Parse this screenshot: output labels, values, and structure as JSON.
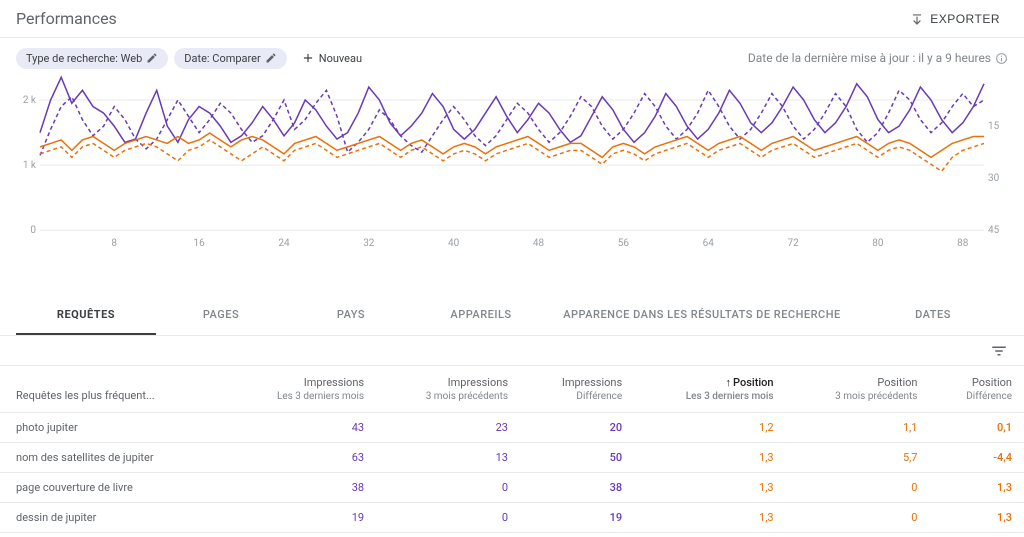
{
  "header": {
    "title": "Performances",
    "export_label": "EXPORTER"
  },
  "toolbar": {
    "chips": [
      {
        "label": "Type de recherche: Web",
        "editable": true
      },
      {
        "label": "Date: Comparer",
        "editable": true
      }
    ],
    "new_label": "Nouveau",
    "update_text": "Date de la dernière mise à jour : il y a 9 heures"
  },
  "tabs": {
    "items": [
      {
        "label": "REQUÊTES",
        "active": true
      },
      {
        "label": "PAGES",
        "active": false
      },
      {
        "label": "PAYS",
        "active": false
      },
      {
        "label": "APPAREILS",
        "active": false
      },
      {
        "label": "APPARENCE DANS LES RÉSULTATS DE RECHERCHE",
        "active": false
      },
      {
        "label": "DATES",
        "active": false
      }
    ]
  },
  "table": {
    "header": {
      "query": "Requêtes les plus fréquent...",
      "imp_cur": "Impressions",
      "imp_cur_sub": "Les 3 derniers mois",
      "imp_prev": "Impressions",
      "imp_prev_sub": "3 mois précédents",
      "imp_diff": "Impressions",
      "imp_diff_sub": "Différence",
      "pos_cur": "Position",
      "pos_cur_sub": "Les 3 derniers mois",
      "pos_prev": "Position",
      "pos_prev_sub": "3 mois précédents",
      "pos_diff": "Position",
      "pos_diff_sub": "Différence"
    },
    "rows": [
      {
        "q": "photo jupiter",
        "ic": "43",
        "ip": "23",
        "id": "20",
        "pc": "1,2",
        "pp": "1,1",
        "pd": "0,1"
      },
      {
        "q": "nom des satellites de jupiter",
        "ic": "63",
        "ip": "13",
        "id": "50",
        "pc": "1,3",
        "pp": "5,7",
        "pd": "-4,4"
      },
      {
        "q": "page couverture de livre",
        "ic": "38",
        "ip": "0",
        "id": "38",
        "pc": "1,3",
        "pp": "0",
        "pd": "1,3"
      },
      {
        "q": "dessin de jupiter",
        "ic": "19",
        "ip": "0",
        "id": "19",
        "pc": "1,3",
        "pp": "0",
        "pd": "1,3"
      }
    ]
  },
  "chart_data": {
    "type": "line",
    "x_ticks": [
      "8",
      "16",
      "24",
      "32",
      "40",
      "48",
      "56",
      "64",
      "72",
      "80",
      "88"
    ],
    "y_left_ticks": [
      "0",
      "1 k",
      "2 k"
    ],
    "y_left_range": [
      0,
      2400
    ],
    "y_right_ticks": [
      "15",
      "30",
      "45"
    ],
    "y_right_range": [
      0,
      45
    ],
    "colors": {
      "impressions": "#673ab7",
      "position": "#e8710a"
    },
    "series": [
      {
        "name": "Impressions — Les 3 derniers mois",
        "axis": "left",
        "style": "solid",
        "color": "#673ab7",
        "values": [
          1500,
          2000,
          2350,
          1950,
          2150,
          1900,
          1800,
          1600,
          1350,
          1400,
          1800,
          2150,
          1600,
          1350,
          1700,
          1900,
          1800,
          1600,
          1350,
          1450,
          1650,
          1900,
          1700,
          1450,
          1650,
          2000,
          1850,
          1600,
          1400,
          1500,
          1800,
          2200,
          2000,
          1650,
          1450,
          1600,
          1800,
          2100,
          1900,
          1550,
          1400,
          1550,
          1800,
          2050,
          1750,
          1500,
          1700,
          1950,
          1800,
          1550,
          1350,
          1450,
          1750,
          2050,
          1850,
          1550,
          1350,
          1500,
          1750,
          2100,
          1900,
          1600,
          1400,
          1550,
          1800,
          2150,
          1950,
          1650,
          1500,
          1650,
          1900,
          2200,
          2000,
          1700,
          1500,
          1650,
          1900,
          2250,
          2050,
          1700,
          1500,
          1600,
          1850,
          2200,
          2000,
          1700,
          1500,
          1650,
          1900,
          2250
        ]
      },
      {
        "name": "Impressions — 3 mois précédents",
        "axis": "left",
        "style": "dashed",
        "color": "#673ab7",
        "values": [
          1150,
          1550,
          1900,
          2050,
          1700,
          1450,
          1600,
          1900,
          1700,
          1400,
          1250,
          1400,
          1700,
          2000,
          1750,
          1500,
          1700,
          1950,
          1800,
          1550,
          1350,
          1450,
          1700,
          2000,
          1550,
          1700,
          1950,
          2150,
          1750,
          1200,
          1350,
          1550,
          1850,
          1700,
          1450,
          1300,
          1200,
          1450,
          1700,
          1900,
          1700,
          1450,
          1300,
          1450,
          1700,
          1950,
          1800,
          1550,
          1350,
          1500,
          1750,
          2050,
          1900,
          1600,
          1400,
          1550,
          1800,
          2100,
          1900,
          1600,
          1400,
          1550,
          1800,
          2150,
          1900,
          1600,
          1400,
          1550,
          1800,
          2100,
          1900,
          1600,
          1400,
          1550,
          1800,
          2100,
          1900,
          1550,
          1350,
          1500,
          1800,
          2150,
          2000,
          1700,
          1500,
          1650,
          1900,
          2100,
          1900,
          2000
        ]
      },
      {
        "name": "Position — Les 3 derniers mois",
        "axis": "right",
        "style": "solid",
        "color": "#e8710a",
        "values": [
          21,
          20,
          19,
          22,
          19,
          18,
          20,
          22,
          20,
          19,
          18,
          19,
          20,
          18,
          20,
          19,
          17,
          19,
          21,
          19,
          18,
          19,
          21,
          23,
          20,
          19,
          18,
          20,
          22,
          21,
          20,
          19,
          18,
          20,
          22,
          20,
          19,
          21,
          23,
          21,
          20,
          21,
          23,
          21,
          20,
          19,
          18,
          20,
          22,
          21,
          20,
          20,
          22,
          24,
          21,
          20,
          21,
          23,
          21,
          20,
          19,
          18,
          20,
          22,
          20,
          19,
          18,
          20,
          22,
          20,
          19,
          18,
          20,
          22,
          21,
          20,
          19,
          18,
          20,
          22,
          20,
          19,
          20,
          22,
          24,
          22,
          20,
          19,
          18,
          18
        ]
      },
      {
        "name": "Position — 3 mois précédents",
        "axis": "right",
        "style": "dashed",
        "color": "#e8710a",
        "values": [
          23,
          22,
          21,
          24,
          21,
          20,
          22,
          24,
          22,
          21,
          20,
          21,
          23,
          25,
          22,
          21,
          19,
          21,
          23,
          25,
          23,
          21,
          23,
          25,
          22,
          21,
          20,
          22,
          24,
          23,
          22,
          21,
          20,
          22,
          24,
          22,
          21,
          23,
          25,
          23,
          22,
          23,
          25,
          23,
          22,
          21,
          20,
          22,
          24,
          23,
          22,
          22,
          24,
          26,
          23,
          22,
          23,
          25,
          23,
          22,
          21,
          20,
          22,
          24,
          22,
          21,
          20,
          22,
          24,
          22,
          21,
          20,
          22,
          24,
          23,
          22,
          21,
          20,
          22,
          24,
          22,
          21,
          22,
          24,
          26,
          28,
          24,
          22,
          21,
          20
        ]
      }
    ]
  }
}
